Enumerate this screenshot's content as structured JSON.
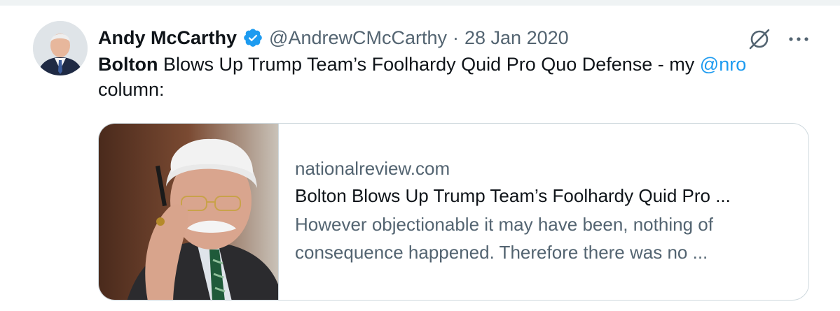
{
  "tweet": {
    "author": {
      "display_name": "Andy McCarthy",
      "handle": "@AndrewCMcCarthy",
      "verified": true
    },
    "separator": "·",
    "date": "28 Jan 2020",
    "text": {
      "bold_word": "Bolton",
      "body": " Blows Up Trump Team’s Foolhardy Quid Pro Quo Defense - my ",
      "mention": "@nro",
      "end": " column:"
    },
    "card": {
      "domain": "nationalreview.com",
      "title": "Bolton Blows Up Trump Team’s Foolhardy Quid Pro ...",
      "description": "However objectionable it may have been, nothing of consequence happened. Therefore there was no ..."
    }
  },
  "icons": {
    "verified": "verified-badge-icon",
    "grok": "grok-icon",
    "more": "more-icon"
  },
  "colors": {
    "text": "#0f1419",
    "secondary": "#536471",
    "link": "#1d9bf0",
    "border": "#cfd9de"
  }
}
